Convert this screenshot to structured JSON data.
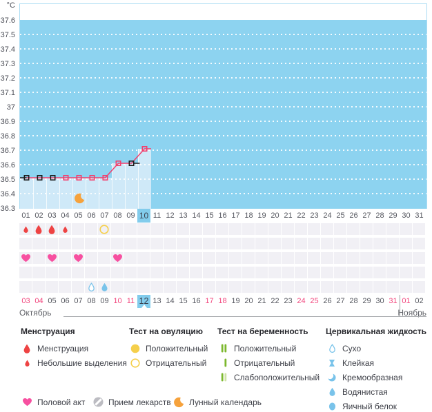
{
  "y_axis": {
    "unit_label": "°C",
    "ticks": [
      "37.6",
      "37.5",
      "37.4",
      "37.3",
      "37.2",
      "37.1",
      "37",
      "36.9",
      "36.8",
      "36.7",
      "36.6",
      "36.5",
      "36.4",
      "36.3"
    ]
  },
  "chart_data": {
    "type": "line",
    "title": "",
    "ylabel": "°C",
    "ylim": [
      36.3,
      37.6
    ],
    "grid": "horizontal-dotted-white",
    "x_cycle_days": [
      1,
      2,
      3,
      4,
      5,
      6,
      7,
      8,
      9,
      10
    ],
    "temperatures": [
      36.51,
      36.51,
      36.51,
      36.51,
      36.51,
      36.51,
      36.51,
      36.61,
      36.61,
      36.71
    ],
    "marker_colors": [
      "black",
      "black",
      "black",
      "pink",
      "pink",
      "pink",
      "pink",
      "pink",
      "black",
      "pink"
    ],
    "black_dash_after_day": 9,
    "moon_icon_day": 5,
    "days_without_data": "11-31"
  },
  "cycle_day_labels": [
    "01",
    "02",
    "03",
    "04",
    "05",
    "06",
    "07",
    "08",
    "09",
    "10",
    "11",
    "12",
    "13",
    "14",
    "15",
    "16",
    "17",
    "18",
    "19",
    "20",
    "21",
    "22",
    "23",
    "24",
    "25",
    "26",
    "27",
    "28",
    "29",
    "30",
    "31"
  ],
  "highlighted_cycle_day": "10",
  "event_rows": [
    {
      "name": "menstruation-and-ovulation-test",
      "cells": [
        {
          "day": 1,
          "icon": "drop-red-small",
          "meaning": "Небольшие выделения"
        },
        {
          "day": 2,
          "icon": "drop-red",
          "meaning": "Менструация"
        },
        {
          "day": 3,
          "icon": "drop-red",
          "meaning": "Менструация"
        },
        {
          "day": 4,
          "icon": "drop-red-small",
          "meaning": "Небольшие выделения"
        },
        {
          "day": 7,
          "icon": "circle-yellow-outline",
          "meaning": "Тест на овуляцию: Отрицательный"
        }
      ]
    },
    {
      "name": "pregnancy-test",
      "cells": []
    },
    {
      "name": "intercourse",
      "cells": [
        {
          "day": 1,
          "icon": "heart-pink",
          "meaning": "Половой акт"
        },
        {
          "day": 3,
          "icon": "heart-pink",
          "meaning": "Половой акт"
        },
        {
          "day": 5,
          "icon": "heart-pink",
          "meaning": "Половой акт"
        },
        {
          "day": 8,
          "icon": "heart-pink",
          "meaning": "Половой акт"
        }
      ]
    },
    {
      "name": "medications",
      "cells": []
    },
    {
      "name": "cervical-fluid",
      "cells": [
        {
          "day": 6,
          "icon": "drop-outline-blue",
          "meaning": "Сухо"
        },
        {
          "day": 7,
          "icon": "drop-blue",
          "meaning": "Водянистая"
        }
      ]
    }
  ],
  "date_row": {
    "highlighted_date": "12",
    "dates": [
      {
        "label": "03",
        "weekend": true
      },
      {
        "label": "04",
        "weekend": true
      },
      {
        "label": "05",
        "weekend": false
      },
      {
        "label": "06",
        "weekend": false
      },
      {
        "label": "07",
        "weekend": false
      },
      {
        "label": "08",
        "weekend": false
      },
      {
        "label": "09",
        "weekend": false
      },
      {
        "label": "10",
        "weekend": true
      },
      {
        "label": "11",
        "weekend": true
      },
      {
        "label": "12",
        "weekend": false
      },
      {
        "label": "13",
        "weekend": false
      },
      {
        "label": "14",
        "weekend": false
      },
      {
        "label": "15",
        "weekend": false
      },
      {
        "label": "16",
        "weekend": false
      },
      {
        "label": "17",
        "weekend": true
      },
      {
        "label": "18",
        "weekend": true
      },
      {
        "label": "19",
        "weekend": false
      },
      {
        "label": "20",
        "weekend": false
      },
      {
        "label": "21",
        "weekend": false
      },
      {
        "label": "22",
        "weekend": false
      },
      {
        "label": "23",
        "weekend": false
      },
      {
        "label": "24",
        "weekend": true
      },
      {
        "label": "25",
        "weekend": true
      },
      {
        "label": "26",
        "weekend": false
      },
      {
        "label": "27",
        "weekend": false
      },
      {
        "label": "28",
        "weekend": false
      },
      {
        "label": "29",
        "weekend": false
      },
      {
        "label": "30",
        "weekend": false
      },
      {
        "label": "31",
        "weekend": true
      },
      {
        "label": "01",
        "weekend": true
      },
      {
        "label": "02",
        "weekend": false
      }
    ]
  },
  "months": {
    "left": "Октябрь",
    "right": "Ноябрь"
  },
  "legend": {
    "columns": [
      {
        "header": "Менструация",
        "items": [
          {
            "icon": "drop-red",
            "label": "Менструация"
          },
          {
            "icon": "drop-red-small",
            "label": "Небольшие выделения"
          }
        ]
      },
      {
        "header": "Тест на овуляцию",
        "items": [
          {
            "icon": "circle-yellow-filled",
            "label": "Положительный"
          },
          {
            "icon": "circle-yellow-outline",
            "label": "Отрицательный"
          }
        ]
      },
      {
        "header": "Тест на беременность",
        "items": [
          {
            "icon": "bars-green-double",
            "label": "Положительный"
          },
          {
            "icon": "bar-green-single",
            "label": "Отрицательный"
          },
          {
            "icon": "bars-green-weak",
            "label": "Слабоположительный"
          }
        ]
      },
      {
        "header": "Цервикальная жидкость",
        "items": [
          {
            "icon": "drop-outline-blue",
            "label": "Сухо"
          },
          {
            "icon": "hourglass-blue",
            "label": "Клейкая"
          },
          {
            "icon": "crescent-blue",
            "label": "Кремообразная"
          },
          {
            "icon": "drop-blue",
            "label": "Водянистая"
          },
          {
            "icon": "oval-blue",
            "label": "Яичный белок"
          }
        ]
      }
    ],
    "footer_items": [
      {
        "icon": "heart-pink",
        "label": "Половой акт"
      },
      {
        "icon": "meds-gray",
        "label": "Прием лекарств"
      },
      {
        "icon": "moon-orange",
        "label": "Лунный календарь"
      }
    ]
  },
  "colors": {
    "plot_blue": "#8dd3f0",
    "fill_blue": "#cfe9f8",
    "row_gray": "#f1f0f5",
    "highlight_blue": "#82ccec",
    "weekend_pink": "#f2477e",
    "line_pink": "#f23f6d",
    "line_black": "#1c1c1c",
    "menstruation_red": "#ee4343",
    "ovulation_yellow": "#f5cf4b",
    "pregnancy_green": "#7cb82e",
    "pregnancy_green_pale": "#cfe3a6",
    "cervical_blue": "#79c3ea",
    "heart_pink": "#f750a0",
    "meds_gray": "#bcbcc2",
    "moon_orange": "#f6a23c",
    "plot_border": "#abdcf3",
    "text_month": "#5f6167"
  }
}
